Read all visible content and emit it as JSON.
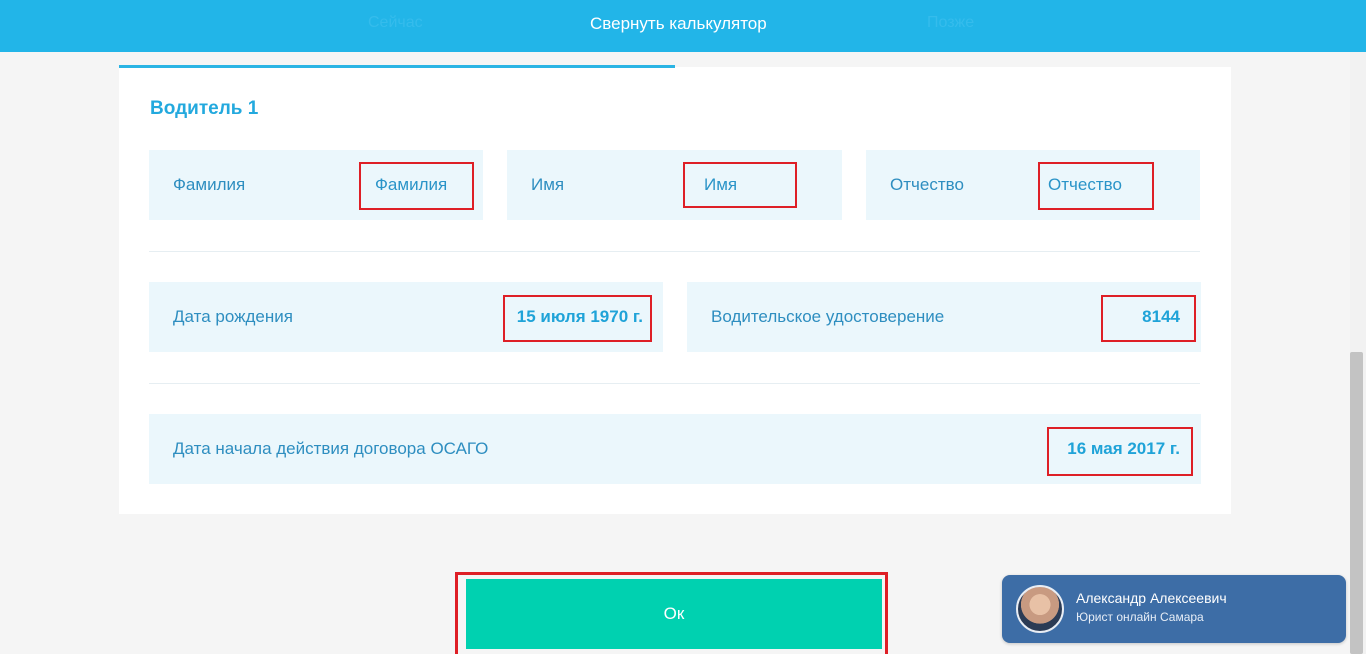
{
  "topbar": {
    "tab_now": "Сейчас",
    "collapse_label": "Свернуть калькулятор",
    "tab_later": "Позже"
  },
  "driver": {
    "heading": "Водитель 1",
    "last_name": {
      "label": "Фамилия",
      "placeholder": "Фамилия"
    },
    "first_name": {
      "label": "Имя",
      "placeholder": "Имя"
    },
    "middle_name": {
      "label": "Отчество",
      "placeholder": "Отчество"
    },
    "birth_date": {
      "label": "Дата рождения",
      "value": "15 июля 1970 г."
    },
    "license": {
      "label": "Водительское удостоверение",
      "value": "8144"
    },
    "policy_start": {
      "label": "Дата начала действия договора ОСАГО",
      "value": "16 мая 2017 г."
    }
  },
  "actions": {
    "ok_label": "Ок"
  },
  "chat": {
    "agent_name": "Александр Алексеевич",
    "agent_role": "Юрист онлайн Самара"
  },
  "colors": {
    "header": "#22b5e8",
    "accent": "#23a9de",
    "field_bg": "#ebf7fc",
    "ok_button": "#00d1b0",
    "highlight": "#de1f26",
    "chat_bg": "#3d6da6"
  }
}
